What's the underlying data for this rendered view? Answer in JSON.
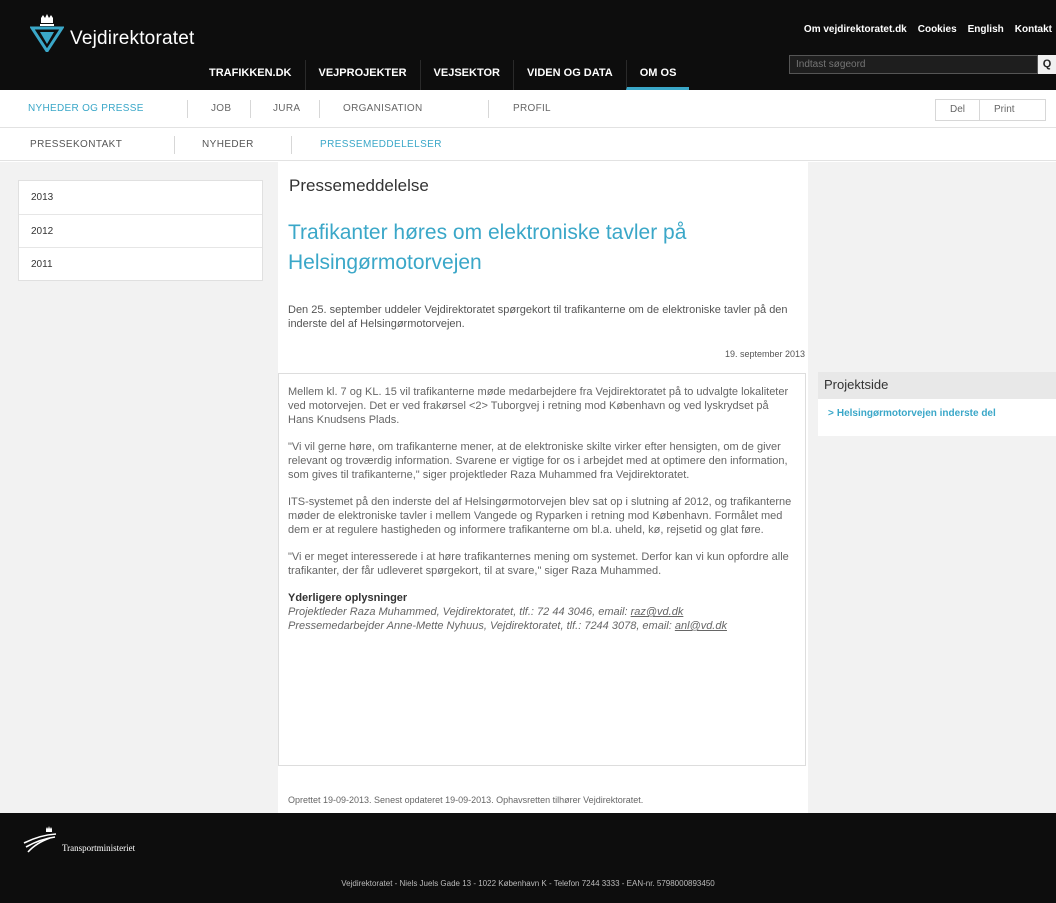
{
  "header": {
    "logo_text": "Vejdirektoratet",
    "top_links": [
      "Om vejdirektoratet.dk",
      "Cookies",
      "English",
      "Kontakt"
    ],
    "search_placeholder": "Indtast søgeord",
    "search_button": "Q",
    "main_nav": [
      {
        "label": "TRAFIKKEN.DK",
        "active": false
      },
      {
        "label": "VEJPROJEKTER",
        "active": false
      },
      {
        "label": "VEJSEKTOR",
        "active": false
      },
      {
        "label": "VIDEN OG DATA",
        "active": false
      },
      {
        "label": "OM OS",
        "active": true
      }
    ],
    "accent_color": "#3aa7c8"
  },
  "subnav": {
    "items": [
      {
        "label": "NYHEDER OG PRESSE",
        "active": true
      },
      {
        "label": "JOB",
        "active": false
      },
      {
        "label": "JURA",
        "active": false
      },
      {
        "label": "ORGANISATION",
        "active": false
      },
      {
        "label": "PROFIL",
        "active": false
      }
    ],
    "share_label": "Del",
    "print_label": "Print"
  },
  "tertnav": {
    "items": [
      {
        "label": "PRESSEKONTAKT",
        "active": false
      },
      {
        "label": "NYHEDER",
        "active": false
      },
      {
        "label": "PRESSEMEDDELELSER",
        "active": true
      }
    ]
  },
  "years": [
    "2013",
    "2012",
    "2011"
  ],
  "article": {
    "section": "Pressemeddelelse",
    "title": "Trafikanter høres om elektroniske tavler på Helsingørmotorvejen",
    "lead": "Den 25. september uddeler Vejdirektoratet spørgekort til trafikanterne om de elektroniske tavler på den inderste del af Helsingørmotorvejen.",
    "date": "19. september 2013",
    "paragraphs": [
      "Mellem kl. 7 og KL. 15 vil trafikanterne møde medarbejdere fra Vejdirektoratet på to udvalgte lokaliteter ved motorvejen. Det er ved frakørsel <2> Tuborgvej i retning mod København og ved lyskrydset på Hans Knudsens Plads.",
      "\"Vi vil gerne høre, om trafikanterne mener, at de elektroniske skilte virker efter hensigten, om de giver relevant og troværdig information. Svarene er vigtige for os i arbejdet med at optimere den information, som gives til trafikanterne,\" siger projektleder Raza Muhammed fra Vejdirektoratet.",
      "ITS-systemet på den inderste del af Helsingørmotorvejen blev sat op i slutning af 2012, og trafikanterne møder de elektroniske tavler i mellem Vangede og Ryparken i retning mod København. Formålet med dem er at regulere hastigheden og informere trafikanterne om bl.a. uheld, kø, rejsetid og glat føre.",
      "\"Vi er meget interesserede i at høre trafikanternes mening om systemet. Derfor kan vi kun opfordre alle trafikanter, der får udleveret spørgekort, til at svare,\" siger Raza Muhammed."
    ],
    "contact_heading": "Yderligere oplysninger",
    "contact1_text": "Projektleder Raza Muhammed, Vejdirektoratet, tlf.: 72 44 3046, email: ",
    "contact1_email": "raz@vd.dk",
    "contact2_text": "Pressemedarbejder Anne-Mette Nyhuus, Vejdirektoratet, tlf.: 7244 3078, email: ",
    "contact2_email": "anl@vd.dk",
    "created": "Oprettet 19-09-2013. Senest opdateret 19-09-2013. Ophavsretten tilhører Vejdirektoratet."
  },
  "sidebar": {
    "heading": "Projektside",
    "link_arrow": ">",
    "link": "Helsingørmotorvejen inderste del"
  },
  "footer": {
    "ministry": "Transportministeriet",
    "address": "Vejdirektoratet - Niels Juels Gade 13 - 1022 København K - Telefon 7244 3333 - EAN-nr. 5798000893450"
  }
}
